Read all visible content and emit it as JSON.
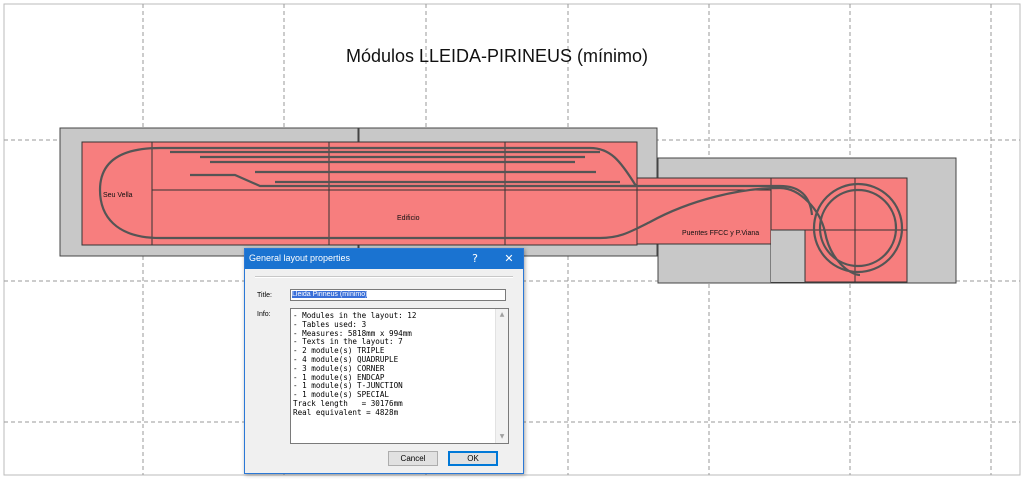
{
  "layout": {
    "title": "Módulos LLEIDA-PIRINEUS (mínimo)",
    "labels": {
      "seu_vella": "Seu Vella",
      "edificio": "Edificio",
      "puentes": "Puentes FFCC y P.Viana"
    },
    "colors": {
      "table_fill": "#c8c8c8",
      "module_fill": "#f77e7e",
      "track": "#555555",
      "grid": "#9a9a9a"
    }
  },
  "dialog": {
    "title": "General layout properties",
    "help_glyph": "?",
    "close_glyph": "✕",
    "title_label": "Title:",
    "title_value": "Lleida Pirineus (mínimo)",
    "info_label": "Info:",
    "info_lines": [
      "- Modules in the layout: 12",
      "- Tables used: 3",
      "- Measures: 5818mm x 994mm",
      "- Texts in the layout: 7",
      "- 2 module(s) TRIPLE",
      "- 4 module(s) QUADRUPLE",
      "- 3 module(s) CORNER",
      "- 1 module(s) ENDCAP",
      "- 1 module(s) T-JUNCTION",
      "- 1 module(s) SPECIAL",
      "Track length   = 30176mm",
      "Real equivalent = 4828m"
    ],
    "cancel_label": "Cancel",
    "ok_label": "OK"
  }
}
